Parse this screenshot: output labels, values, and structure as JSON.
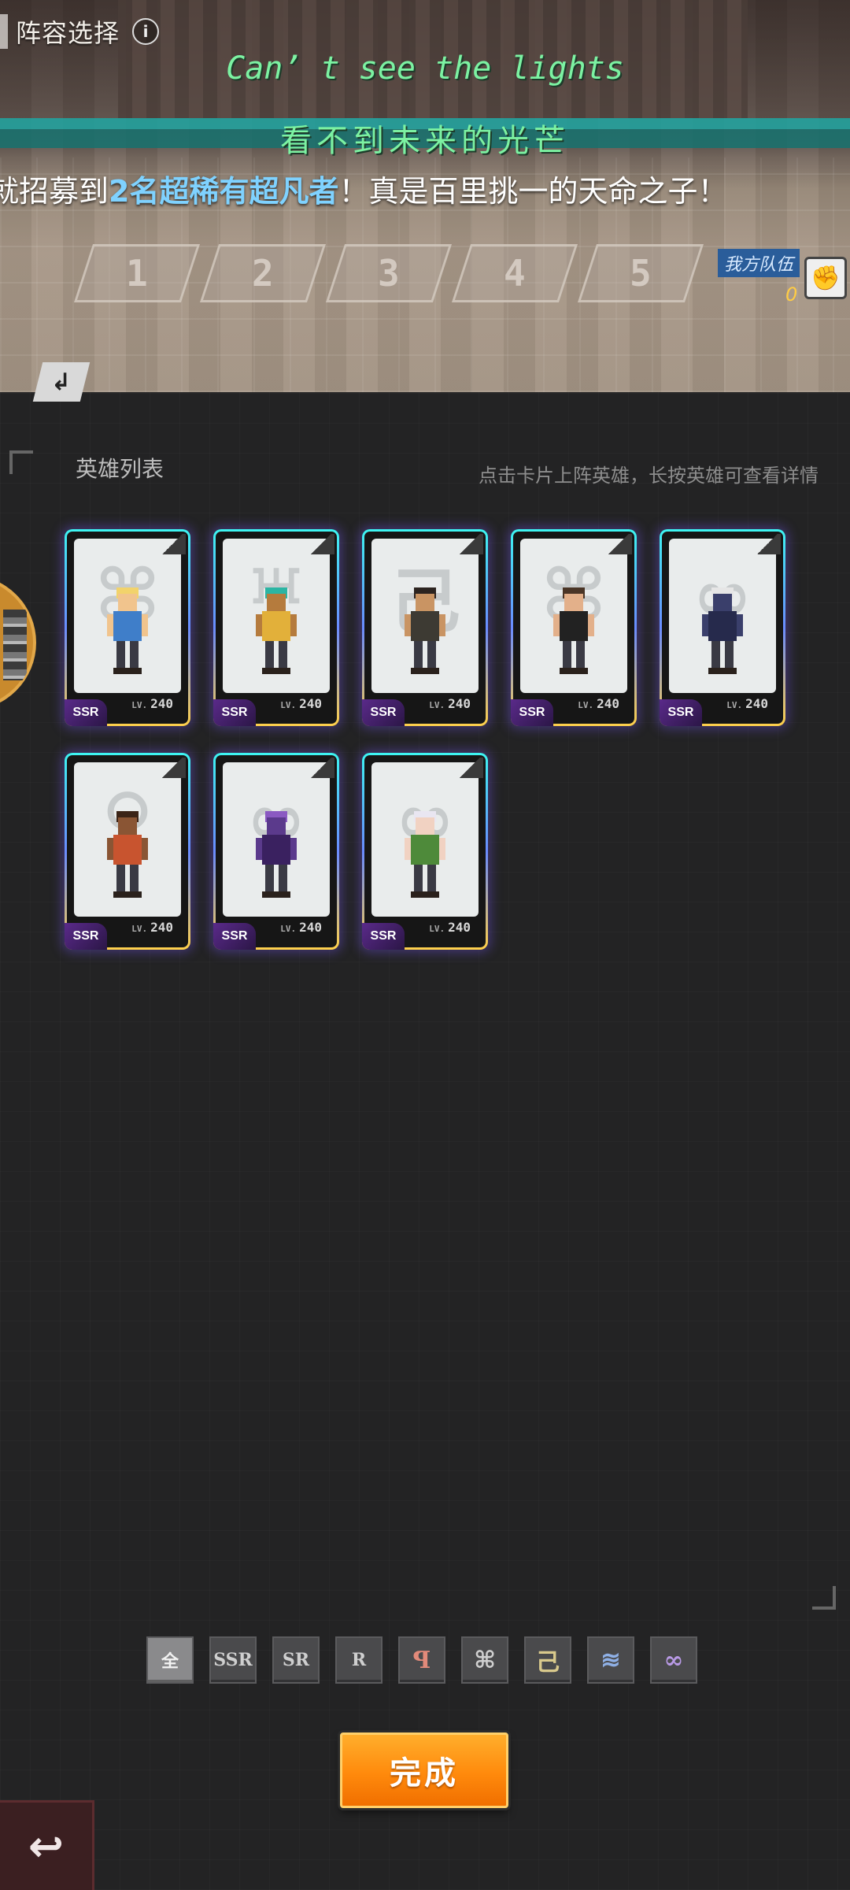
{
  "header": {
    "title": "阵容选择",
    "info_icon": "info-icon"
  },
  "lyrics": {
    "english": "Can’ t see the lights",
    "chinese": "看不到未来的光芒"
  },
  "banner": {
    "prefix": "就招募到",
    "highlight": "2名超稀有超凡者",
    "suffix": "！真是百里挑一的天命之子！"
  },
  "formation": {
    "slots": [
      "1",
      "2",
      "3",
      "4",
      "5"
    ],
    "team_label": "我方队伍",
    "team_count": "0"
  },
  "hero_list": {
    "title": "英雄列表",
    "hint": "点击卡片上阵英雄，长按英雄可查看详情",
    "level_prefix": "LV.",
    "cards": [
      {
        "name": "cowgirl-hero",
        "rarity": "SSR",
        "level": "240",
        "emblem": "⌘",
        "skin": "#f1c48d",
        "outfit": "#3f7ec9",
        "hair": "#f2d36b"
      },
      {
        "name": "golden-pharaoh-hero",
        "rarity": "SSR",
        "level": "240",
        "emblem": "♅",
        "skin": "#b57b3d",
        "outfit": "#e2b03a",
        "hair": "#2bb5a3"
      },
      {
        "name": "axe-warrior-hero",
        "rarity": "SSR",
        "level": "240",
        "emblem": "己",
        "skin": "#c99463",
        "outfit": "#3d3a33",
        "hair": "#2c2420"
      },
      {
        "name": "suited-gentleman-hero",
        "rarity": "SSR",
        "level": "240",
        "emblem": "⌘",
        "skin": "#e3b08a",
        "outfit": "#222222",
        "hair": "#4a3526"
      },
      {
        "name": "shadow-beast-hero",
        "rarity": "SSR",
        "level": "240",
        "emblem": "∞",
        "skin": "#3a3f6b",
        "outfit": "#262a4c",
        "hair": "#e6e6e6"
      },
      {
        "name": "tribal-girl-hero",
        "rarity": "SSR",
        "level": "240",
        "emblem": "♀",
        "skin": "#8a5534",
        "outfit": "#c8542f",
        "hair": "#3b2417"
      },
      {
        "name": "purple-dragon-hero",
        "rarity": "SSR",
        "level": "240",
        "emblem": "∞",
        "skin": "#5b3a8c",
        "outfit": "#3a2160",
        "hair": "#8b5ac2"
      },
      {
        "name": "naga-maiden-hero",
        "rarity": "SSR",
        "level": "240",
        "emblem": "∞",
        "skin": "#f1d2c2",
        "outfit": "#4e8a3a",
        "hair": "#e9e6f1"
      }
    ]
  },
  "filters": [
    {
      "label": "全",
      "name": "filter-all",
      "active": true
    },
    {
      "label": "SSR",
      "name": "filter-ssr"
    },
    {
      "label": "SR",
      "name": "filter-sr"
    },
    {
      "label": "R",
      "name": "filter-r"
    },
    {
      "label": "ꟼ",
      "name": "filter-faction-1-icon",
      "glyph": true,
      "color": "#e38a7a"
    },
    {
      "label": "⌘",
      "name": "filter-faction-2-icon",
      "glyph": true,
      "color": "#cfcfcf"
    },
    {
      "label": "己",
      "name": "filter-faction-3-icon",
      "glyph": true,
      "color": "#d9c98c"
    },
    {
      "label": "≋",
      "name": "filter-faction-4-icon",
      "glyph": true,
      "color": "#8fb0e6"
    },
    {
      "label": "∞",
      "name": "filter-faction-5-icon",
      "glyph": true,
      "color": "#b99ae6"
    }
  ],
  "actions": {
    "done_label": "完成",
    "back_icon": "back-arrow-icon",
    "swap_icon": "swap-arrow-icon",
    "fist_icon": "fist-icon"
  },
  "colors": {
    "accent_orange": "#ff8a0c",
    "lyric_green": "#7cf2a2",
    "banner_highlight": "#7fd2ff",
    "card_glow": "#6a8cff"
  }
}
